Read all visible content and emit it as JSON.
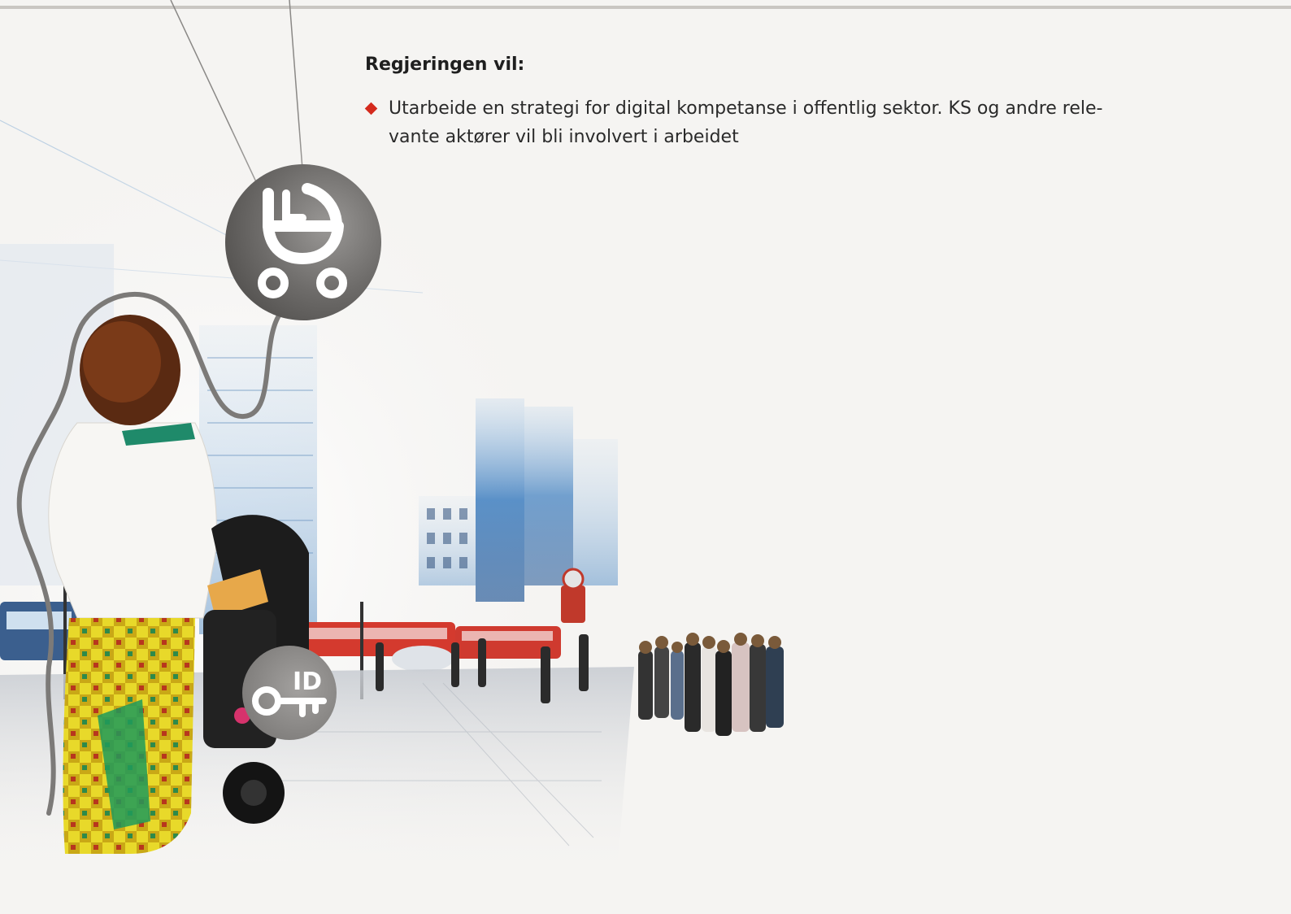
{
  "section": {
    "heading": "Regjeringen vil:",
    "bullets": [
      {
        "line1": "Utarbeide en strategi for digital kompetanse i offentlig sektor. KS og andre rele-",
        "line2": "vante aktører vil bli involvert i arbeidet"
      }
    ]
  },
  "illustration": {
    "badge_top_icon": "baby-stroller-icon",
    "badge_bottom_icon": "id-key-icon",
    "badge_bottom_text": "ID"
  },
  "colors": {
    "page_background": "#f5f4f2",
    "bullet_accent": "#d42a1d",
    "rule": "#c9c6c2"
  }
}
